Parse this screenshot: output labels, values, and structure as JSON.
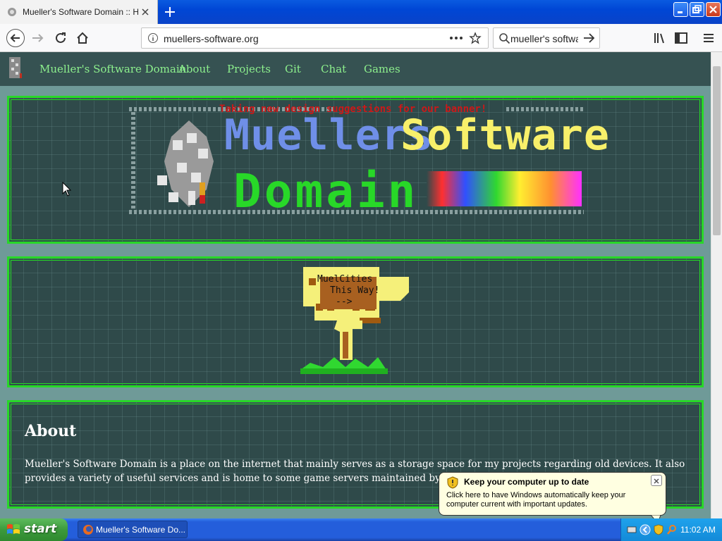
{
  "browser": {
    "tab_title": "Mueller's Software Domain :: Home",
    "url": "muellers-software.org",
    "search_text": "mueller's software"
  },
  "site": {
    "nav": [
      "Mueller's Software Domain",
      "About",
      "Projects",
      "Git",
      "Chat",
      "Games"
    ],
    "banner_note": "Taking new design suggestions for our banner!",
    "banner_words": [
      "Muellers",
      "Software",
      "Domain"
    ],
    "sign_text": [
      "MuelCities",
      "This Way!",
      "-->"
    ],
    "about_title": "About",
    "about_text": "Mueller's Software Domain is a place on the internet that mainly serves as a storage space for my projects regarding old devices. It also provides a variety of useful services and is home to some game servers maintained by me."
  },
  "balloon": {
    "title": "Keep your computer up to date",
    "body": "Click here to have Windows automatically keep your computer current with important updates."
  },
  "taskbar": {
    "start_label": "start",
    "task_label": "Mueller's Software Do...",
    "clock": "11:02 AM"
  },
  "colors": {
    "accent_green": "#27d827",
    "nav_link": "#8df08d",
    "banner_blue": "#6f8fe8",
    "banner_yellow": "#f8f06a"
  }
}
